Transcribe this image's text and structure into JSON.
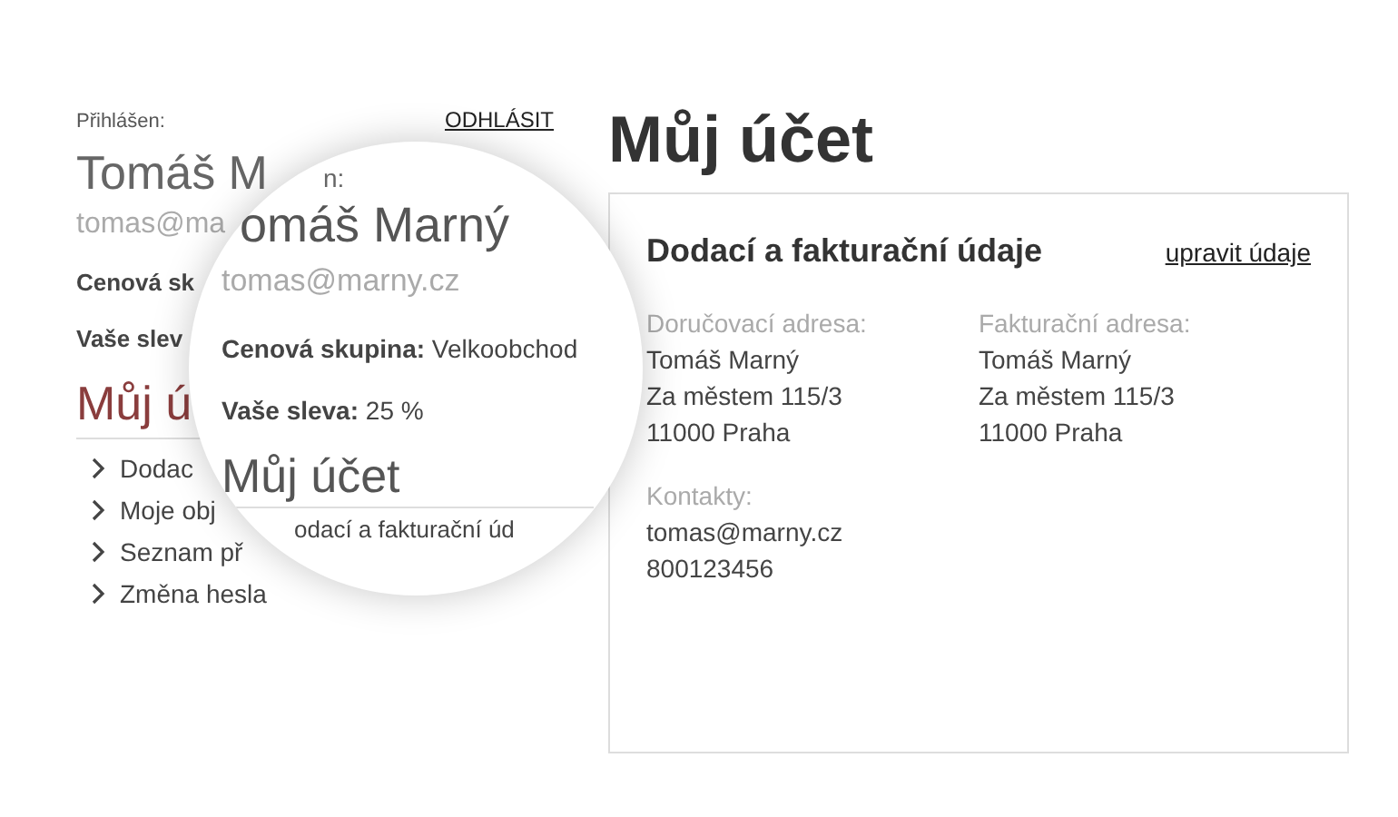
{
  "sidebar": {
    "logged_in_label": "Přihlášen:",
    "logout_link": "ODHLÁSIT",
    "user_name": "Tomáš M",
    "user_email": "tomas@ma",
    "price_group_label": "Cenová sk",
    "discount_label": "Vaše slev",
    "section_title": "Můj ú",
    "menu": [
      "Dodac",
      "Moje obj",
      "Seznam př",
      "Změna hesla"
    ]
  },
  "magnifier": {
    "logged_in_label": "n:",
    "user_name": "omáš Marný",
    "user_email": "tomas@marny.cz",
    "price_group_label": "Cenová skupina:",
    "price_group_value": "Velkoobchod",
    "discount_label": "Vaše sleva:",
    "discount_value": "25 %",
    "section_title": "Můj účet",
    "menu_item": "odací a fakturační úd"
  },
  "page_title": "Můj účet",
  "card": {
    "title": "Dodací a fakturační údaje",
    "edit_link": "upravit údaje",
    "columns": [
      {
        "label": "Doručovací adresa:",
        "lines": [
          "Tomáš Marný",
          "Za městem 115/3",
          "11000 Praha"
        ]
      },
      {
        "label": "Fakturační adresa:",
        "lines": [
          "Tomáš Marný",
          "Za městem 115/3",
          "11000 Praha"
        ]
      }
    ],
    "contacts": {
      "label": "Kontakty:",
      "lines": [
        "tomas@marny.cz",
        "800123456"
      ]
    }
  }
}
